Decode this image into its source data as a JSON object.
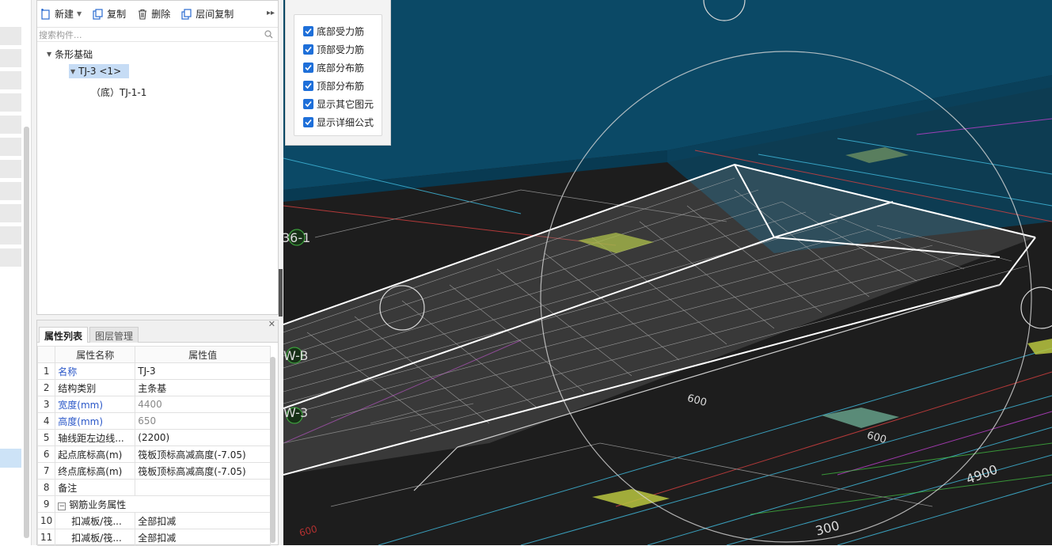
{
  "toolbar": {
    "new_label": "新建",
    "copy_label": "复制",
    "delete_label": "删除",
    "floor_copy_label": "层间复制"
  },
  "search": {
    "placeholder": "搜索构件..."
  },
  "tree": {
    "root": "条形基础",
    "child": "TJ-3 <1>",
    "leaf": "（底）TJ-1-1"
  },
  "props": {
    "tabs": [
      "属性列表",
      "图层管理"
    ],
    "header_name": "属性名称",
    "header_value": "属性值",
    "rows": [
      {
        "no": "1",
        "name": "名称",
        "value": "TJ-3"
      },
      {
        "no": "2",
        "name": "结构类别",
        "value": "主条基"
      },
      {
        "no": "3",
        "name": "宽度(mm)",
        "value": "4400"
      },
      {
        "no": "4",
        "name": "高度(mm)",
        "value": "650"
      },
      {
        "no": "5",
        "name": "轴线距左边线...",
        "value": "(2200)"
      },
      {
        "no": "6",
        "name": "起点底标高(m)",
        "value": "筏板顶标高减高度(-7.05)"
      },
      {
        "no": "7",
        "name": "终点底标高(m)",
        "value": "筏板顶标高减高度(-7.05)"
      },
      {
        "no": "8",
        "name": "备注",
        "value": ""
      },
      {
        "no": "9",
        "name": "钢筋业务属性",
        "value": ""
      },
      {
        "no": "10",
        "name": "扣减板/筏...",
        "value": "全部扣减"
      },
      {
        "no": "11",
        "name": "扣减板/筏...",
        "value": "全部扣减"
      }
    ]
  },
  "checks": [
    "底部受力筋",
    "顶部受力筋",
    "底部分布筋",
    "顶部分布筋",
    "显示其它图元",
    "显示详细公式"
  ],
  "viewport": {
    "labels": {
      "axis1": "36-1",
      "axis2": "W-B",
      "axis3": "W-3",
      "dim1": "600",
      "dim2": "600",
      "dim3": "4900",
      "dim4": "300",
      "dim5": "600"
    }
  },
  "colors": {
    "accent": "#1e6fd9",
    "selected": "#c6dcf5",
    "slab": "#0b4966",
    "viewport_bg": "#1d1d1d"
  }
}
